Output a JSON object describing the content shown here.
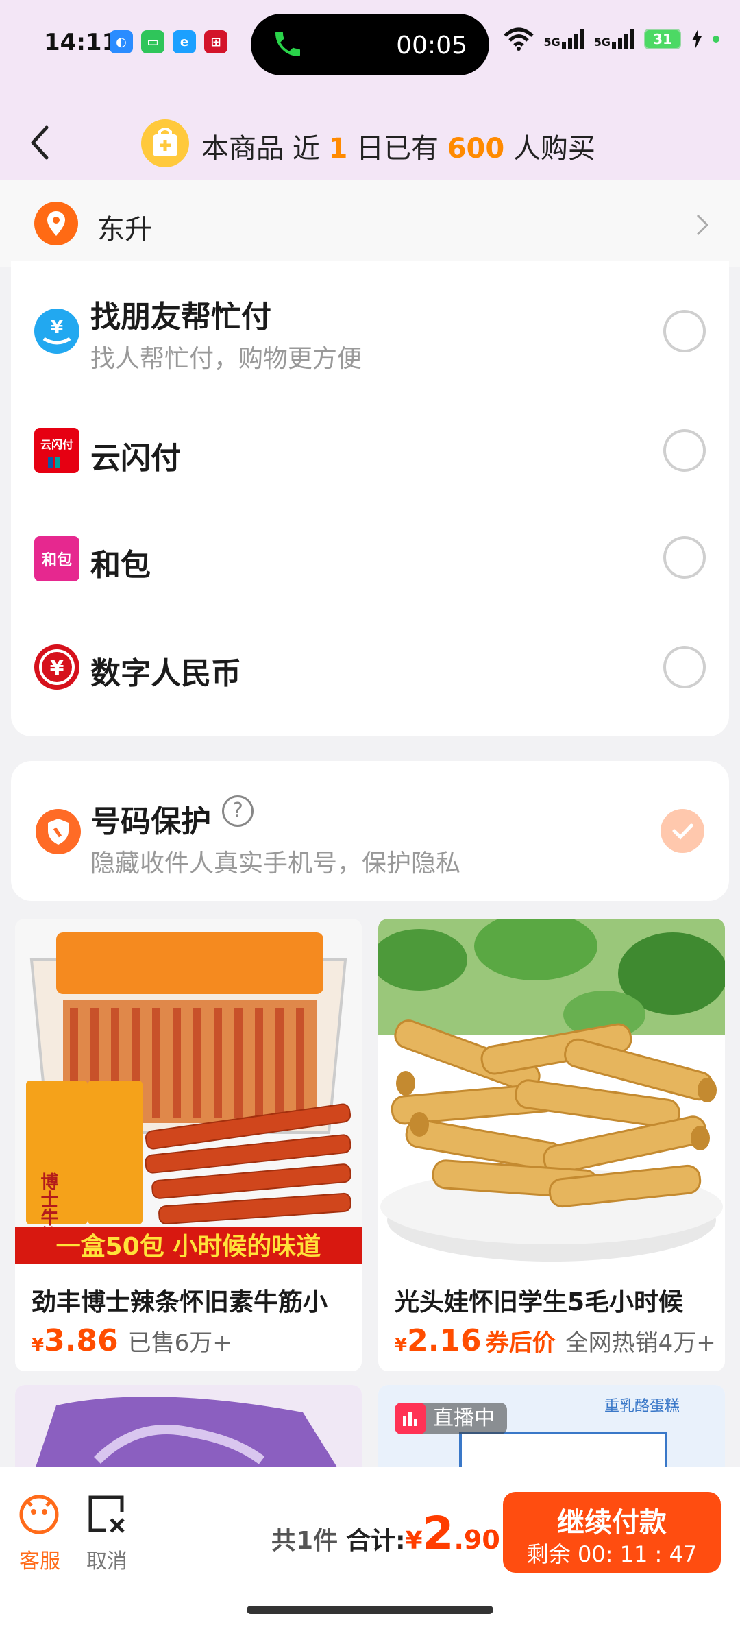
{
  "status_bar": {
    "time": "14:11",
    "call_duration": "00:05",
    "network_1": "5G",
    "network_2": "5G",
    "battery": "31"
  },
  "header": {
    "banner_prefix": "本商品 近",
    "banner_days": "1",
    "banner_mid": "日已有",
    "banner_count": "600",
    "banner_suffix": "人购买"
  },
  "location": {
    "label": "东升"
  },
  "payment_methods": [
    {
      "title": "找朋友帮忙付",
      "subtitle": "找人帮忙付，购物更方便",
      "icon": "friend-pay-icon",
      "icon_text": "¥"
    },
    {
      "title": "云闪付",
      "subtitle": "",
      "icon": "unionpay-icon",
      "icon_text": "云闪付"
    },
    {
      "title": "和包",
      "subtitle": "",
      "icon": "hebao-icon",
      "icon_text": "和包"
    },
    {
      "title": "数字人民币",
      "subtitle": "",
      "icon": "ecny-icon",
      "icon_text": "¥"
    }
  ],
  "number_protection": {
    "title": "号码保护",
    "help": "?",
    "subtitle": "隐藏收件人真实手机号，保护隐私",
    "checked": true
  },
  "products": [
    {
      "name": "劲丰博士辣条怀旧素牛筋小",
      "price_symbol": "¥",
      "price": "3.86",
      "tag": "",
      "sold": "已售6万+",
      "image_banner": "一盒50包 小时候的味道",
      "image_pack_text": "博士牛筋"
    },
    {
      "name": "光头娃怀旧学生5毛小时候",
      "price_symbol": "¥",
      "price": "2.16",
      "tag": "券后价",
      "sold": "全网热销4万+"
    }
  ],
  "products_row2": [
    {
      "live_label": "",
      "image_text": ""
    },
    {
      "live_label": "直播中",
      "image_text": "重乳酪蛋糕"
    }
  ],
  "bottom_bar": {
    "service_label": "客服",
    "cancel_label": "取消",
    "count": "共1件",
    "total_label": "合计:",
    "currency": "¥",
    "total_int": "2",
    "total_dec": ".90",
    "button_label": "继续付款",
    "countdown": "剩余 00: 11 : 47"
  },
  "colors": {
    "accent": "#ff4d10",
    "price": "#ff4d00",
    "header_bg": "#f3e6f6"
  }
}
